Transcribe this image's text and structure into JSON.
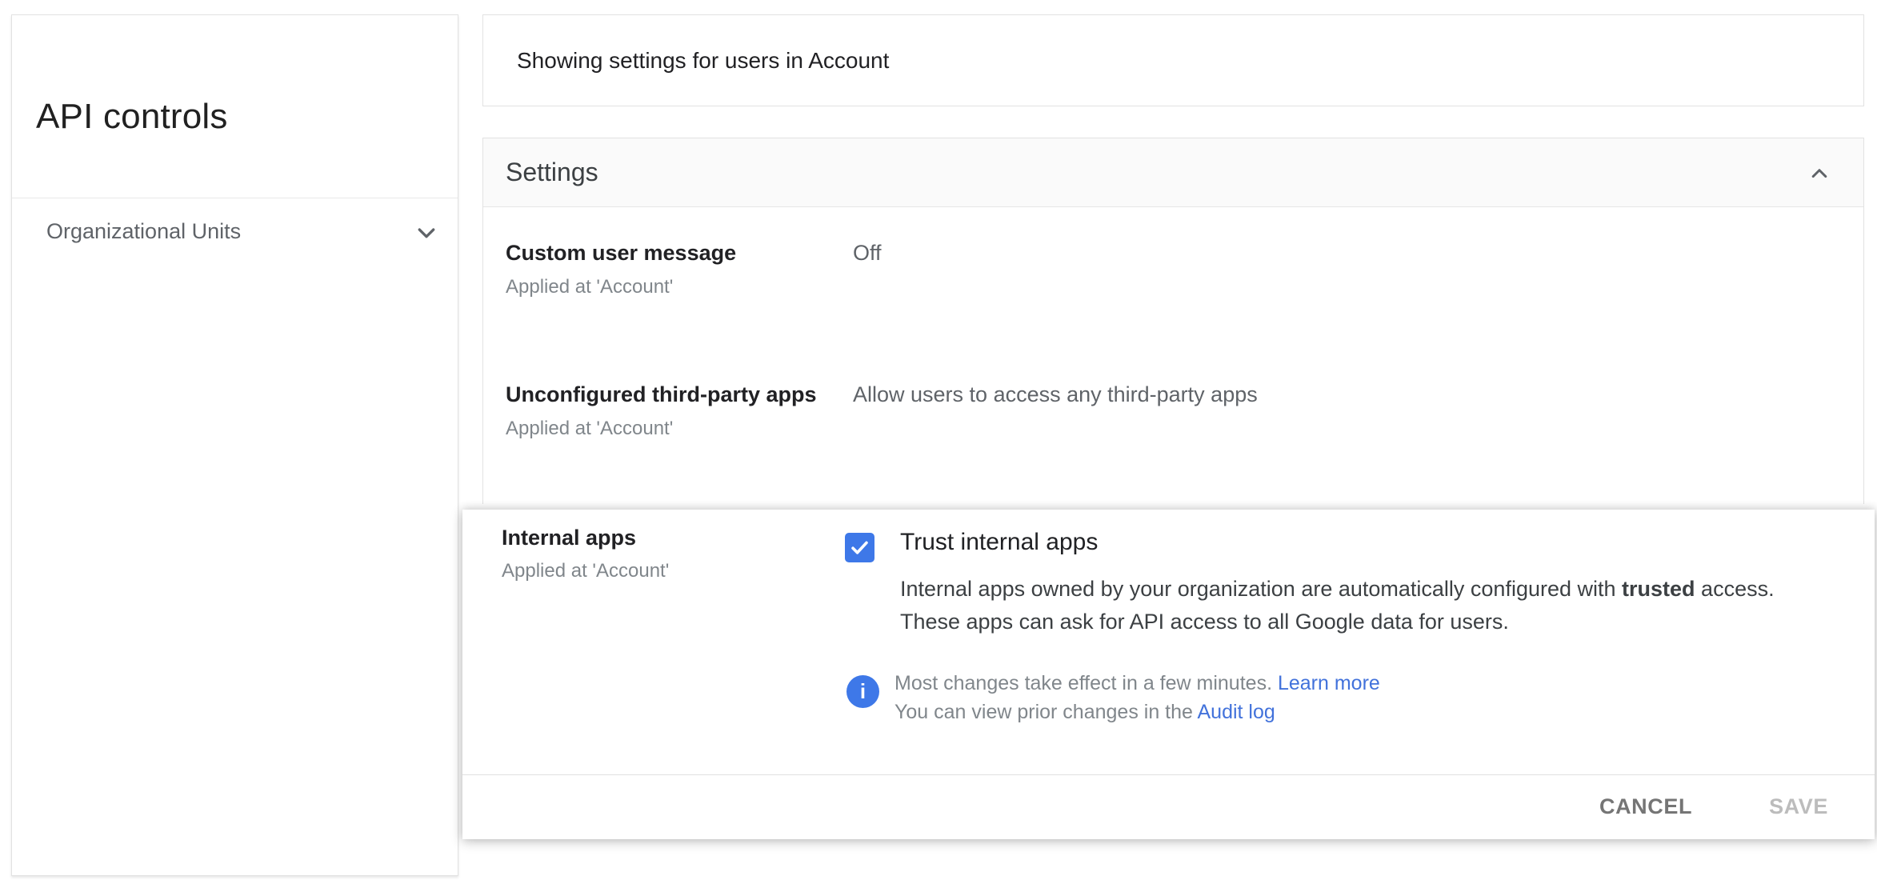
{
  "sidebar": {
    "title": "API controls",
    "org_units_label": "Organizational Units"
  },
  "header": {
    "scope_text": "Showing settings for users in Account"
  },
  "settings_card": {
    "title": "Settings",
    "rows": [
      {
        "label": "Custom user message",
        "applied_at": "Applied at 'Account'",
        "value": "Off"
      },
      {
        "label": "Unconfigured third-party apps",
        "applied_at": "Applied at 'Account'",
        "value": "Allow users to access any third-party apps"
      }
    ]
  },
  "internal_apps_panel": {
    "label": "Internal apps",
    "applied_at": "Applied at 'Account'",
    "checkbox": {
      "label": "Trust internal apps",
      "checked": true
    },
    "description": {
      "prefix": "Internal apps owned by your organization are automatically configured with ",
      "bold": "trusted",
      "suffix": " access.",
      "line2": "These apps can ask for API access to all Google data for users."
    },
    "notice": {
      "line1_text": "Most changes take effect in a few minutes. ",
      "line1_link": "Learn more",
      "line2_text": "You can view prior changes in the ",
      "line2_link": "Audit log",
      "info_icon_glyph": "i"
    },
    "buttons": {
      "cancel": "CANCEL",
      "save": "SAVE"
    }
  },
  "colors": {
    "checkbox_blue": "#3e78e8",
    "info_blue": "#3e78e8",
    "link_blue": "#4272db",
    "header_bg": "#fafafa",
    "border": "#e2e2e2",
    "text_dark": "#212124",
    "text_gray": "#5f6368",
    "text_light_gray": "#80868b",
    "save_disabled": "#bcbcbc"
  }
}
